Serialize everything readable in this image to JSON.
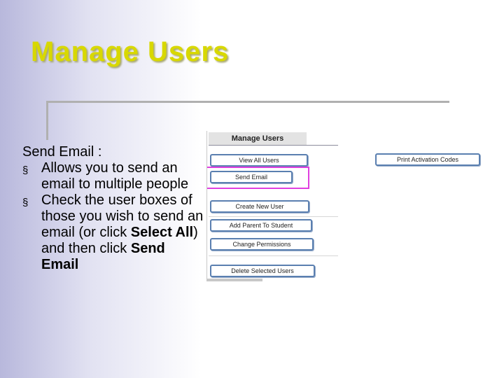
{
  "slide": {
    "title": "Manage Users",
    "title_color": "#d8d800",
    "heading_label": "Send Email",
    "heading_colon": " :",
    "bullets": [
      {
        "marker": "§",
        "text": "Allows you to send an email to multiple people"
      },
      {
        "marker": "§",
        "pre": "Check the user boxes of those you wish to send an email (or click ",
        "bold1": "Select All",
        "mid": ") and then click ",
        "bold2": "Send Email"
      }
    ]
  },
  "screenshot": {
    "header": "Manage Users",
    "buttons": {
      "view_all_users": "View All Users",
      "send_email": "Send Email",
      "create_new_user": "Create New User",
      "add_parent_to_student": "Add Parent To Student",
      "change_permissions": "Change Permissions",
      "delete_selected_users": "Delete Selected Users",
      "print_activation_codes": "Print Activation Codes"
    },
    "highlight_color": "#e040e0",
    "button_border_color": "#5a7fb0"
  }
}
